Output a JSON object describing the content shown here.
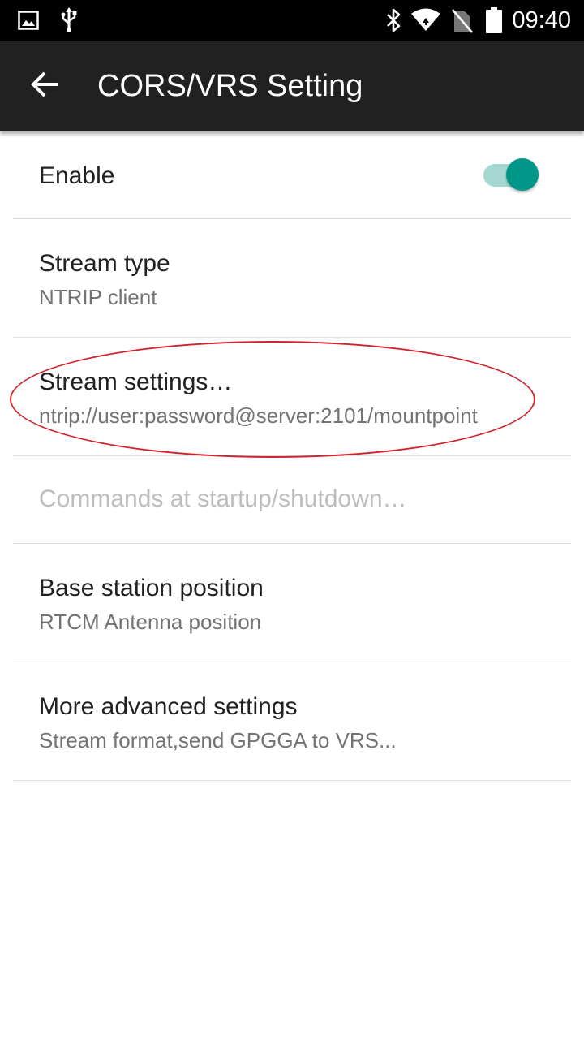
{
  "status_bar": {
    "time": "09:40",
    "left_icons": [
      "image-notification-icon",
      "usb-icon"
    ],
    "right_icons": [
      "bluetooth-icon",
      "wifi-icon",
      "no-sim-icon",
      "battery-icon"
    ]
  },
  "app_bar": {
    "title": "CORS/VRS Setting",
    "back_icon": "arrow-back-icon"
  },
  "preferences": {
    "enable": {
      "title": "Enable",
      "checked": true
    },
    "stream_type": {
      "title": "Stream type",
      "summary": "NTRIP client"
    },
    "stream_settings": {
      "title": "Stream settings…",
      "summary": "ntrip://user:password@server:2101/mountpoint"
    },
    "commands": {
      "title": "Commands at startup/shutdown…",
      "enabled": false
    },
    "base_station": {
      "title": "Base station position",
      "summary": "RTCM Antenna position"
    },
    "advanced": {
      "title": "More advanced settings",
      "summary": "Stream format,send GPGGA to VRS..."
    }
  },
  "colors": {
    "accent": "#009688",
    "accent_track": "#a5d8d2",
    "app_bar": "#212121",
    "annotation": "#d0252d"
  }
}
